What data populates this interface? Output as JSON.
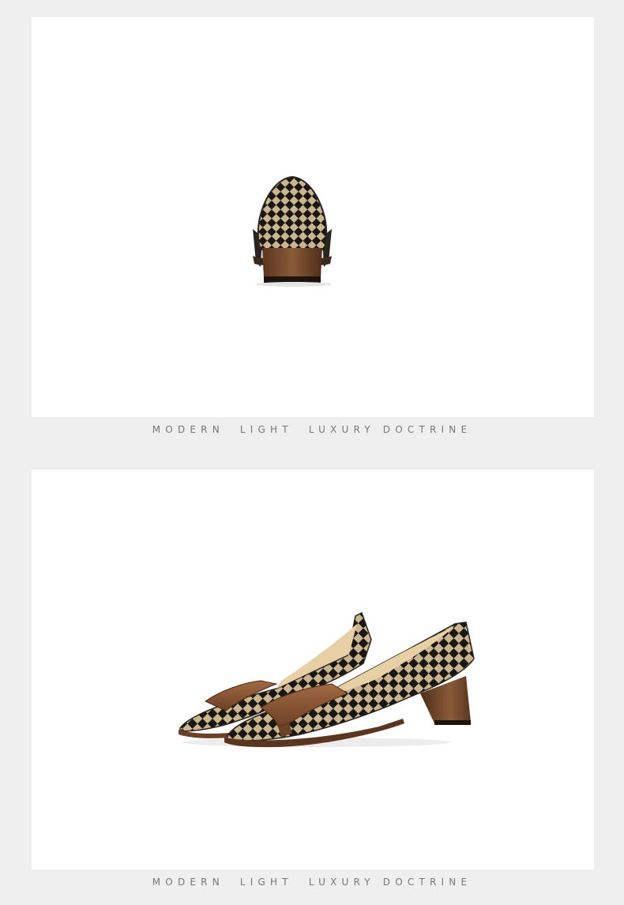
{
  "sections": [
    {
      "caption": "MODERN  LIGHT  LUXURY DOCTRINE",
      "image_subject": "shoe-back-view"
    },
    {
      "caption": "MODERN  LIGHT  LUXURY DOCTRINE",
      "image_subject": "shoe-pair-side-view"
    }
  ],
  "colors": {
    "page_background": "#efefef",
    "panel_background": "#ffffff",
    "caption_text": "#777777",
    "check_dark": "#1a1612",
    "check_light": "#c9b590",
    "strap_brown": "#8a5634",
    "heel_brown": "#6b4128",
    "lining": "#e7cfa6"
  }
}
